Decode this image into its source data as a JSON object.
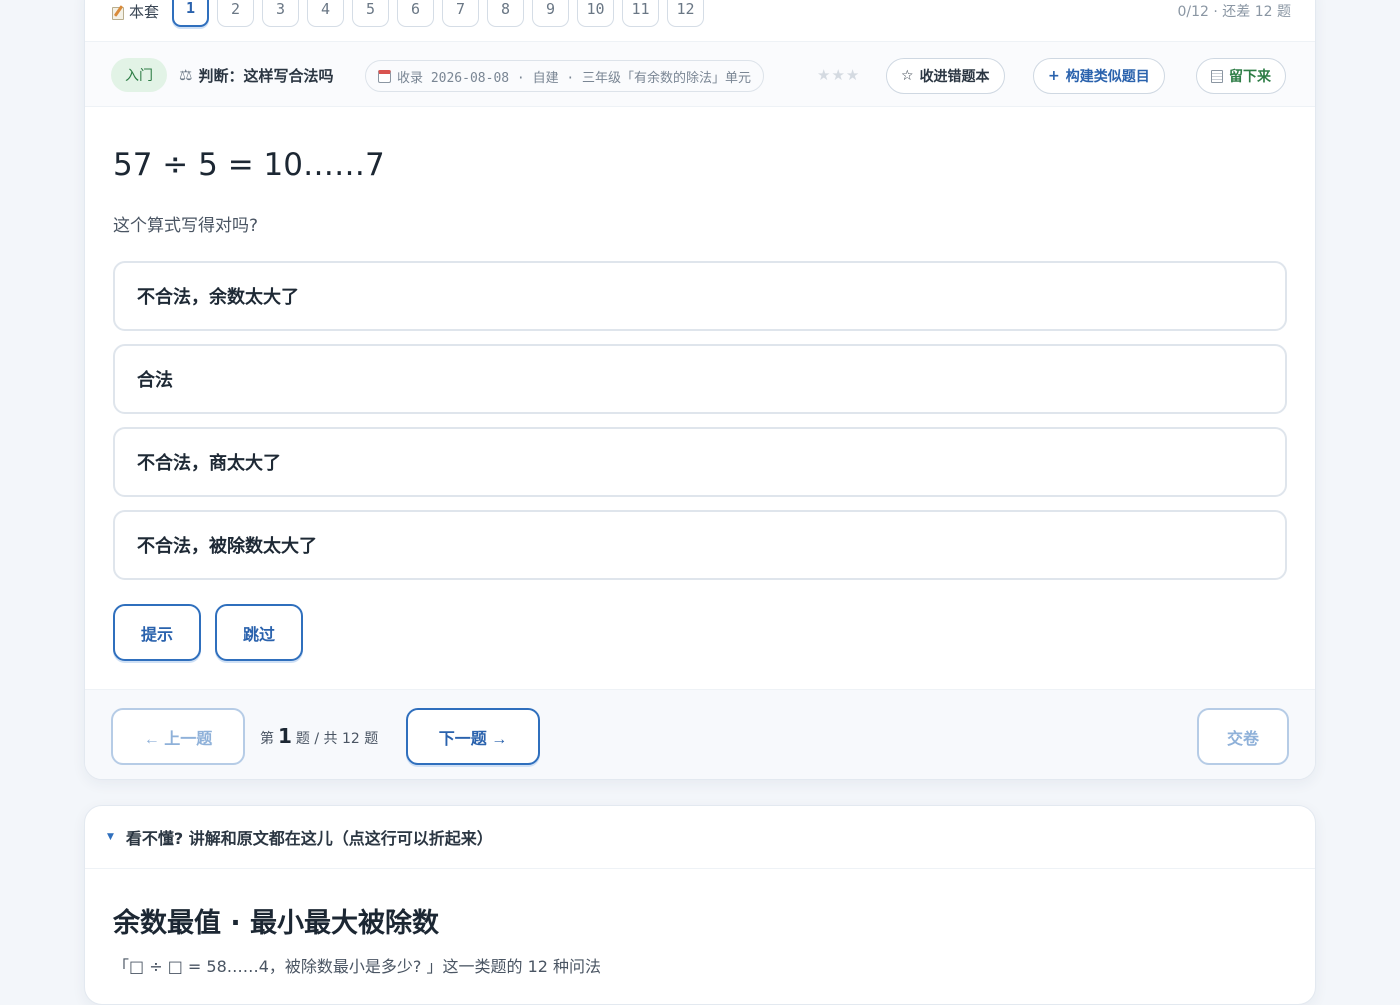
{
  "pager": {
    "set_label": "本套",
    "pages": [
      "1",
      "2",
      "3",
      "4",
      "5",
      "6",
      "7",
      "8",
      "9",
      "10",
      "11",
      "12"
    ],
    "active_page": "1",
    "progress_text": "0/12 · 还差 12 题"
  },
  "meta": {
    "level": "入门",
    "question_type": "判断：这样写合法吗",
    "source": "收录 2026-08-08 · 自建 · 三年级「有余数的除法」单元",
    "stars": "★★★",
    "collect_label": "收进错题本",
    "similar_label": "构建类似题目",
    "keep_label": "留下来"
  },
  "question": {
    "equation": "57 ÷ 5 = 10……7",
    "prompt": "这个算式写得对吗?",
    "options": [
      "不合法，余数太大了",
      "合法",
      "不合法，商太大了",
      "不合法，被除数太大了"
    ],
    "hint_label": "提示",
    "skip_label": "跳过"
  },
  "nav": {
    "prev_label": "← 上一题",
    "counter_prefix": "第",
    "current": "1",
    "counter_suffix": "题 / 共 12 题",
    "next_label": "下一题 →",
    "submit_label": "交卷"
  },
  "explain": {
    "toggle_label": "看不懂? 讲解和原文都在这儿（点这行可以折起来）",
    "title": "余数最值 · 最小最大被除数",
    "subtitle": "「□ ÷ □ = 58……4，被除数最小是多少? 」这一类题的 12 种问法"
  },
  "colors": {
    "accent": "#2f6fbd",
    "level_bg": "#e2f3e6",
    "level_text": "#2e7d46",
    "disabled_border": "#b6cce6"
  }
}
